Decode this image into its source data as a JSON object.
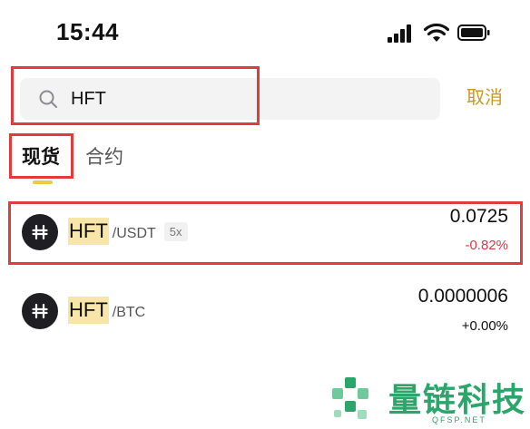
{
  "status_bar": {
    "time": "15:44"
  },
  "search": {
    "query": "HFT",
    "cancel_label": "取消"
  },
  "tabs": [
    {
      "label": "现货",
      "active": true
    },
    {
      "label": "合约",
      "active": false
    }
  ],
  "results": [
    {
      "base": "HFT",
      "quote": "/USDT",
      "leverage": "5x",
      "price": "0.0725",
      "change": "-0.82%"
    },
    {
      "base": "HFT",
      "quote": "/BTC",
      "price": "0.0000006",
      "change": "+0.00%"
    }
  ],
  "watermark": {
    "text": "量链科技",
    "sub": "QFSP.NET"
  },
  "colors": {
    "accent": "#c99a1d",
    "negative": "#d33b46",
    "highlight": "#f7e6a8",
    "annotation": "#e23b3b"
  }
}
